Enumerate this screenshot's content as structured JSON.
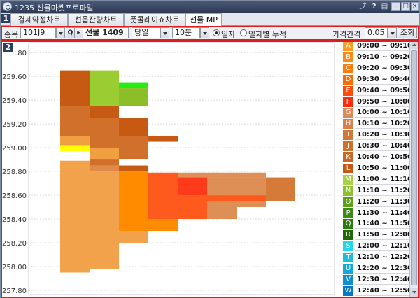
{
  "window": {
    "title": "1235 선물마켓프로파일"
  },
  "tabs": [
    {
      "label": "결제약정차트",
      "active": false
    },
    {
      "label": "선옵잔량차트",
      "active": false
    },
    {
      "label": "풋콜레이쇼차트",
      "active": false
    },
    {
      "label": "선물 MP",
      "active": true
    }
  ],
  "section_markers": [
    "1",
    "2"
  ],
  "toolbar": {
    "item_label": "종목",
    "item_code": "101J9",
    "item_name": "선물 1409",
    "day_select": "당일",
    "interval_select": "10분",
    "radio_day": "일자",
    "radio_cumulative": "일자별 누적",
    "price_step_label": "가격간격",
    "price_step_value": "0.05",
    "query_button": "조회",
    "search_icon_glyph": "Q"
  },
  "chart_data": {
    "type": "heatmap",
    "ylim": [
      257.8,
      259.83
    ],
    "yticks": [
      {
        "value": 259.8,
        "label": ".80"
      },
      {
        "value": 259.6,
        "label": "259.60"
      },
      {
        "value": 259.4,
        "label": "259.40"
      },
      {
        "value": 259.2,
        "label": "259.20"
      },
      {
        "value": 259.0,
        "label": "259.00"
      },
      {
        "value": 258.8,
        "label": "258.80"
      },
      {
        "value": 258.6,
        "label": "258.60"
      },
      {
        "value": 258.4,
        "label": "258.40"
      },
      {
        "value": 258.2,
        "label": "258.20"
      },
      {
        "value": 258.0,
        "label": "258.00"
      },
      {
        "value": 257.8,
        "label": "257.80"
      }
    ],
    "grid": true,
    "blocks": [
      {
        "col": 0,
        "y1": 259.65,
        "y2": 259.35,
        "color": "#c75a12"
      },
      {
        "col": 0,
        "y1": 259.35,
        "y2": 259.1,
        "color": "#d0702a"
      },
      {
        "col": 0,
        "y1": 259.1,
        "y2": 259.02,
        "color": "#f0a040"
      },
      {
        "col": 0,
        "y1": 259.02,
        "y2": 258.97,
        "color": "#ffff00"
      },
      {
        "col": 0,
        "y1": 258.97,
        "y2": 258.9,
        "color": "#ffffff"
      },
      {
        "col": 0,
        "y1": 258.89,
        "y2": 257.95,
        "color": "#f2a24a"
      },
      {
        "col": 1,
        "y1": 259.65,
        "y2": 259.35,
        "color": "#9acd32"
      },
      {
        "col": 1,
        "y1": 259.35,
        "y2": 259.25,
        "color": "#c75a12"
      },
      {
        "col": 1,
        "y1": 259.25,
        "y2": 259.0,
        "color": "#d0702a"
      },
      {
        "col": 1,
        "y1": 259.0,
        "y2": 258.9,
        "color": "#f0a040"
      },
      {
        "col": 1,
        "y1": 258.9,
        "y2": 258.85,
        "color": "#d0702a"
      },
      {
        "col": 1,
        "y1": 258.85,
        "y2": 258.8,
        "color": "#e08a4a"
      },
      {
        "col": 1,
        "y1": 258.8,
        "y2": 257.98,
        "color": "#f2a24a"
      },
      {
        "col": 2,
        "y1": 259.55,
        "y2": 259.5,
        "color": "#22ee11"
      },
      {
        "col": 2,
        "y1": 259.5,
        "y2": 259.35,
        "color": "#8cbe28"
      },
      {
        "col": 2,
        "y1": 259.25,
        "y2": 259.1,
        "color": "#c75a12"
      },
      {
        "col": 2,
        "y1": 259.1,
        "y2": 258.9,
        "color": "#d0702a"
      },
      {
        "col": 2,
        "y1": 258.85,
        "y2": 258.8,
        "color": "#c75a12"
      },
      {
        "col": 2,
        "y1": 258.8,
        "y2": 258.3,
        "color": "#ff8c00"
      },
      {
        "col": 2,
        "y1": 258.3,
        "y2": 258.2,
        "color": "#f2a24a"
      },
      {
        "col": 3,
        "y1": 259.1,
        "y2": 259.05,
        "color": "#c75a12"
      },
      {
        "col": 3,
        "y1": 258.79,
        "y2": 258.4,
        "color": "#ff5a1e"
      },
      {
        "col": 3,
        "y1": 258.4,
        "y2": 258.3,
        "color": "#ff8c00"
      },
      {
        "col": 4,
        "y1": 258.79,
        "y2": 258.75,
        "color": "#de8f55"
      },
      {
        "col": 4,
        "y1": 258.75,
        "y2": 258.6,
        "color": "#ff3a1a"
      },
      {
        "col": 4,
        "y1": 258.6,
        "y2": 258.4,
        "color": "#ff5a1e"
      },
      {
        "col": 5,
        "y1": 258.79,
        "y2": 258.75,
        "color": "#de8f55"
      },
      {
        "col": 5,
        "y1": 258.75,
        "y2": 258.6,
        "color": "#de8f55"
      },
      {
        "col": 5,
        "y1": 258.6,
        "y2": 258.55,
        "color": "#ff5a1e"
      },
      {
        "col": 5,
        "y1": 258.55,
        "y2": 258.4,
        "color": "#de8f55"
      },
      {
        "col": 6,
        "y1": 258.79,
        "y2": 258.75,
        "color": "#de8f55"
      },
      {
        "col": 6,
        "y1": 258.75,
        "y2": 258.6,
        "color": "#de8f55"
      },
      {
        "col": 6,
        "y1": 258.6,
        "y2": 258.55,
        "color": "#ff5a1e"
      },
      {
        "col": 6,
        "y1": 258.55,
        "y2": 258.5,
        "color": "#de8f55"
      },
      {
        "col": 7,
        "y1": 258.75,
        "y2": 258.55,
        "color": "#d57a38"
      }
    ]
  },
  "time_slots": [
    {
      "letter": "A",
      "time": "09:00 ~ 09:10",
      "color": "#ff9a22"
    },
    {
      "letter": "B",
      "time": "09:10 ~ 09:20",
      "color": "#ff8a12"
    },
    {
      "letter": "C",
      "time": "09:20 ~ 09:30",
      "color": "#ff7a08"
    },
    {
      "letter": "D",
      "time": "09:30 ~ 09:40",
      "color": "#ff6a00"
    },
    {
      "letter": "E",
      "time": "09:40 ~ 09:50",
      "color": "#ff4a0a"
    },
    {
      "letter": "F",
      "time": "09:50 ~ 10:00",
      "color": "#ff2a0a"
    },
    {
      "letter": "G",
      "time": "10:00 ~ 10:10",
      "color": "#dd8855"
    },
    {
      "letter": "H",
      "time": "10:10 ~ 10:20",
      "color": "#d88048"
    },
    {
      "letter": "I",
      "time": "10:20 ~ 10:30",
      "color": "#d47838"
    },
    {
      "letter": "J",
      "time": "10:30 ~ 10:40",
      "color": "#d0702a"
    },
    {
      "letter": "K",
      "time": "10:40 ~ 10:50",
      "color": "#cc6620"
    },
    {
      "letter": "L",
      "time": "10:50 ~ 11:00",
      "color": "#c75a12"
    },
    {
      "letter": "M",
      "time": "11:00 ~ 11:10",
      "color": "#a8d048"
    },
    {
      "letter": "N",
      "time": "11:10 ~ 11:20",
      "color": "#8ec030"
    },
    {
      "letter": "O",
      "time": "11:20 ~ 11:30",
      "color": "#5aa018"
    },
    {
      "letter": "P",
      "time": "11:30 ~ 11:40",
      "color": "#3a8a14"
    },
    {
      "letter": "Q",
      "time": "11:40 ~ 11:50",
      "color": "#2a7a0e"
    },
    {
      "letter": "R",
      "time": "11:50 ~ 12:00",
      "color": "#1e6a08"
    },
    {
      "letter": "S",
      "time": "12:00 ~ 12:10",
      "color": "#22d8e8"
    },
    {
      "letter": "T",
      "time": "12:10 ~ 12:20",
      "color": "#18c0e0"
    },
    {
      "letter": "U",
      "time": "12:20 ~ 12:30",
      "color": "#12a8d8"
    },
    {
      "letter": "V",
      "time": "12:30 ~ 12:40",
      "color": "#0e90d0"
    },
    {
      "letter": "W",
      "time": "12:40 ~ 12:50",
      "color": "#0a78c4"
    }
  ]
}
